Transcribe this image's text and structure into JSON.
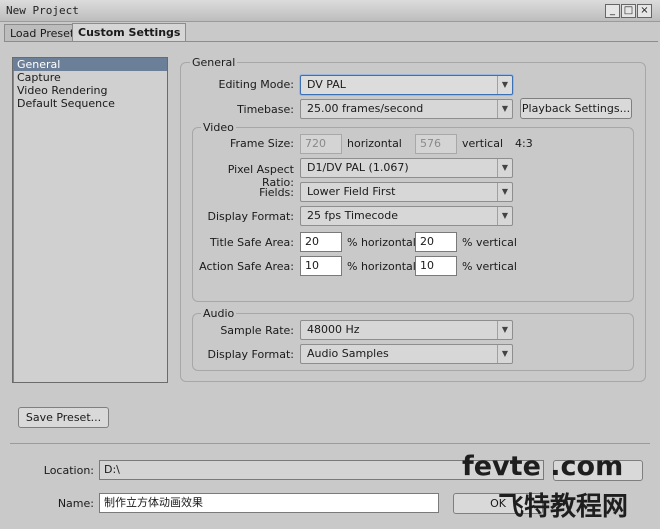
{
  "window": {
    "title": "New Project"
  },
  "tabs": {
    "load_preset": "Load Preset",
    "custom_settings": "Custom Settings"
  },
  "categories": [
    "General",
    "Capture",
    "Video Rendering",
    "Default Sequence"
  ],
  "general": {
    "group_label": "General",
    "editing_mode_label": "Editing Mode:",
    "editing_mode_value": "DV PAL",
    "timebase_label": "Timebase:",
    "timebase_value": "25.00 frames/second",
    "playback_settings_button": "Playback Settings..."
  },
  "video": {
    "group_label": "Video",
    "frame_size_label": "Frame Size:",
    "frame_width": "720",
    "horizontal_text": "horizontal",
    "frame_height": "576",
    "vertical_text": "vertical",
    "aspect_ratio_text": "4:3",
    "pixel_aspect_label": "Pixel Aspect Ratio:",
    "pixel_aspect_value": "D1/DV PAL (1.067)",
    "fields_label": "Fields:",
    "fields_value": "Lower Field First",
    "display_format_label": "Display Format:",
    "display_format_value": "25 fps Timecode",
    "title_safe_label": "Title Safe Area:",
    "title_safe_h": "20",
    "title_safe_v": "20",
    "action_safe_label": "Action Safe Area:",
    "action_safe_h": "10",
    "action_safe_v": "10",
    "pct_horizontal": "% horizontal",
    "pct_vertical": "% vertical"
  },
  "audio": {
    "group_label": "Audio",
    "sample_rate_label": "Sample Rate:",
    "sample_rate_value": "48000 Hz",
    "display_format_label": "Display Format:",
    "display_format_value": "Audio Samples"
  },
  "footer": {
    "save_preset_button": "Save Preset...",
    "location_label": "Location:",
    "location_value": "D:\\",
    "name_label": "Name:",
    "name_value": "制作立方体动画效果",
    "ok_button": "OK"
  },
  "watermark": {
    "line1": "fevte .com",
    "line2": "飞特教程网"
  }
}
